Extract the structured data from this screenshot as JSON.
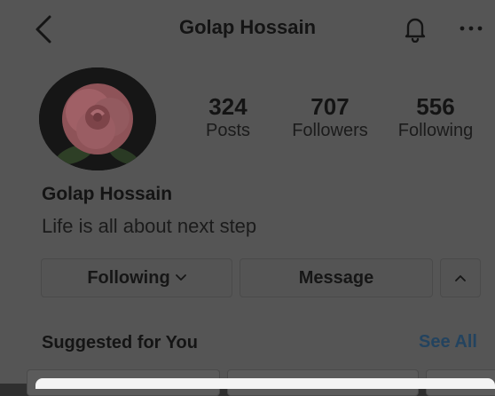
{
  "header": {
    "title": "Golap Hossain"
  },
  "profile": {
    "stats": [
      {
        "value": "324",
        "label": "Posts"
      },
      {
        "value": "707",
        "label": "Followers"
      },
      {
        "value": "556",
        "label": "Following"
      }
    ],
    "name": "Golap Hossain",
    "bio": "Life is all about next step"
  },
  "actions": {
    "following_label": "Following",
    "message_label": "Message"
  },
  "suggested": {
    "title": "Suggested for You",
    "see_all": "See All"
  },
  "icons": {
    "back": "chevron-left-icon",
    "bell": "bell-icon",
    "more": "more-icon",
    "following_chevron": "chevron-down-icon",
    "suggest_toggle": "chevron-up-icon"
  },
  "colors": {
    "overlay": "#555555",
    "link": "#23435f"
  }
}
